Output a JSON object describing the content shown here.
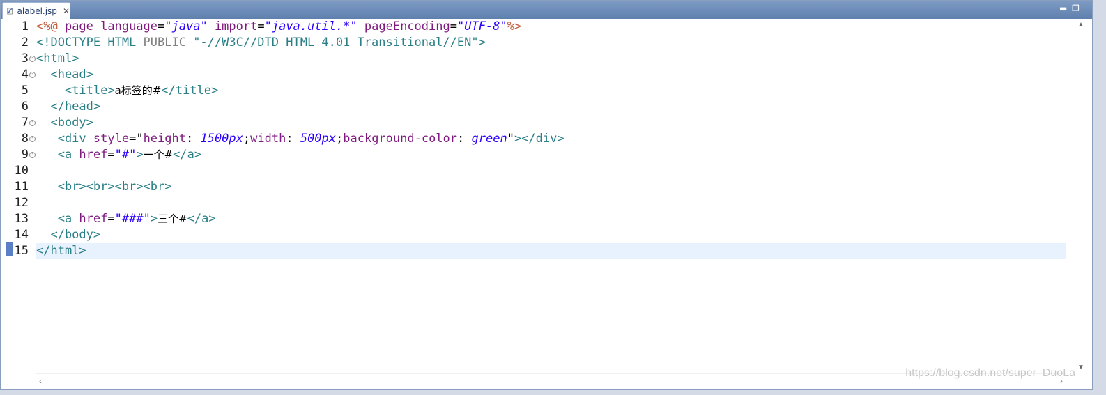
{
  "tab": {
    "title": "alabel.jsp",
    "close": "✕",
    "icon": "jsp-file-icon"
  },
  "window_controls": {
    "minimize": "▬",
    "maximize": "❐"
  },
  "watermark": "https://blog.csdn.net/super_DuoLa",
  "lines": [
    {
      "n": "1",
      "fold": false
    },
    {
      "n": "2",
      "fold": false
    },
    {
      "n": "3",
      "fold": true
    },
    {
      "n": "4",
      "fold": true
    },
    {
      "n": "5",
      "fold": false
    },
    {
      "n": "6",
      "fold": false
    },
    {
      "n": "7",
      "fold": true
    },
    {
      "n": "8",
      "fold": true
    },
    {
      "n": "9",
      "fold": true
    },
    {
      "n": "10",
      "fold": false
    },
    {
      "n": "11",
      "fold": false
    },
    {
      "n": "12",
      "fold": false
    },
    {
      "n": "13",
      "fold": false
    },
    {
      "n": "14",
      "fold": false
    },
    {
      "n": "15",
      "fold": false
    }
  ],
  "code": {
    "l1": {
      "a": "<%@",
      "b": " page ",
      "c": "language",
      "d": "=",
      "e": "\"java\"",
      "f": " import",
      "g": "=",
      "h": "\"java.util.*\"",
      "i": " pageEncoding",
      "j": "=",
      "k": "\"UTF-8\"",
      "l": "%>"
    },
    "l2": {
      "a": "<!DOCTYPE HTML ",
      "b": "PUBLIC",
      "c": " \"-//W3C//DTD HTML 4.01 Transitional//EN\">"
    },
    "l3": {
      "a": "<html>"
    },
    "l4": {
      "a": "  <head>"
    },
    "l5": {
      "a": "    <title>",
      "b": "a标签的#",
      "c": "</title>"
    },
    "l6": {
      "a": "  </head>"
    },
    "l7": {
      "a": "  <body>"
    },
    "l8": {
      "a": "   <div ",
      "b": "style",
      "c": "=\"",
      "d": "height",
      "e": ": ",
      "f": "1500px",
      "g": ";",
      "h": "width",
      "i": ": ",
      "j": "500px",
      "k": ";",
      "l": "background-color",
      "m": ": ",
      "n": "green",
      "o": "\"",
      "p": "></div>"
    },
    "l9": {
      "a": "   <a ",
      "b": "href",
      "c": "=",
      "d": "\"#\"",
      "e": ">",
      "f": "一个#",
      "g": "</a>"
    },
    "l11": {
      "a": "   <br><br><br><br>"
    },
    "l13": {
      "a": "   <a ",
      "b": "href",
      "c": "=",
      "d": "\"###\"",
      "e": ">",
      "f": "三个#",
      "g": "</a>"
    },
    "l14": {
      "a": "  </body>"
    },
    "l15": {
      "a": "</html>"
    }
  }
}
